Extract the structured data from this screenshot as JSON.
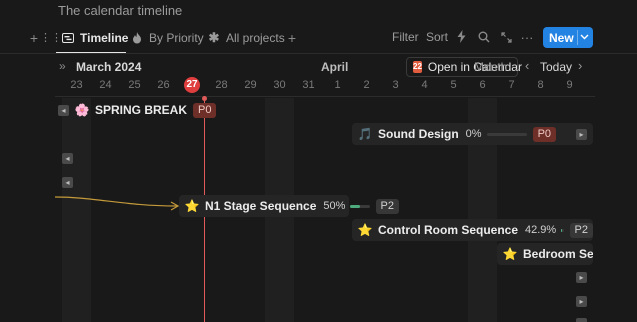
{
  "page": {
    "title": "The calendar timeline"
  },
  "views": {
    "tabs": [
      {
        "label": "Timeline",
        "icon": "timeline-icon"
      },
      {
        "label": "By Priority",
        "icon": "fire-icon"
      },
      {
        "label": "All projects",
        "icon": "asterisk-icon"
      }
    ],
    "toolbar": {
      "filter": "Filter",
      "sort": "Sort",
      "new": "New"
    }
  },
  "calendar": {
    "month_left": "March 2024",
    "month_right": "April",
    "open_in_calendar": "Open in Calendar",
    "scale": "Month",
    "today": "Today",
    "days": [
      "23",
      "24",
      "25",
      "26",
      "27",
      "28",
      "29",
      "30",
      "31",
      "1",
      "2",
      "3",
      "4",
      "5",
      "6",
      "7",
      "8",
      "9"
    ],
    "today_date": "27"
  },
  "items": [
    {
      "name": "SPRING BREAK",
      "emoji": "🌸",
      "priority": "P0"
    },
    {
      "name": "Sound Design",
      "emoji": "🎵",
      "progress": "0%",
      "progress_value": 0,
      "priority": "P0"
    },
    {
      "name": "N1 Stage Sequence",
      "emoji": "⭐",
      "progress": "50%",
      "progress_value": 0.5,
      "priority": "P2"
    },
    {
      "name": "Control Room Sequence",
      "emoji": "⭐",
      "progress": "42.9%",
      "progress_value": 0.429,
      "priority": "P2"
    },
    {
      "name": "Bedroom Sequence",
      "emoji": "⭐"
    }
  ],
  "colors": {
    "accent": "#2383e2",
    "today": "#e03e3e",
    "progress": "#4dab7d",
    "dependency": "#c49a3a"
  }
}
